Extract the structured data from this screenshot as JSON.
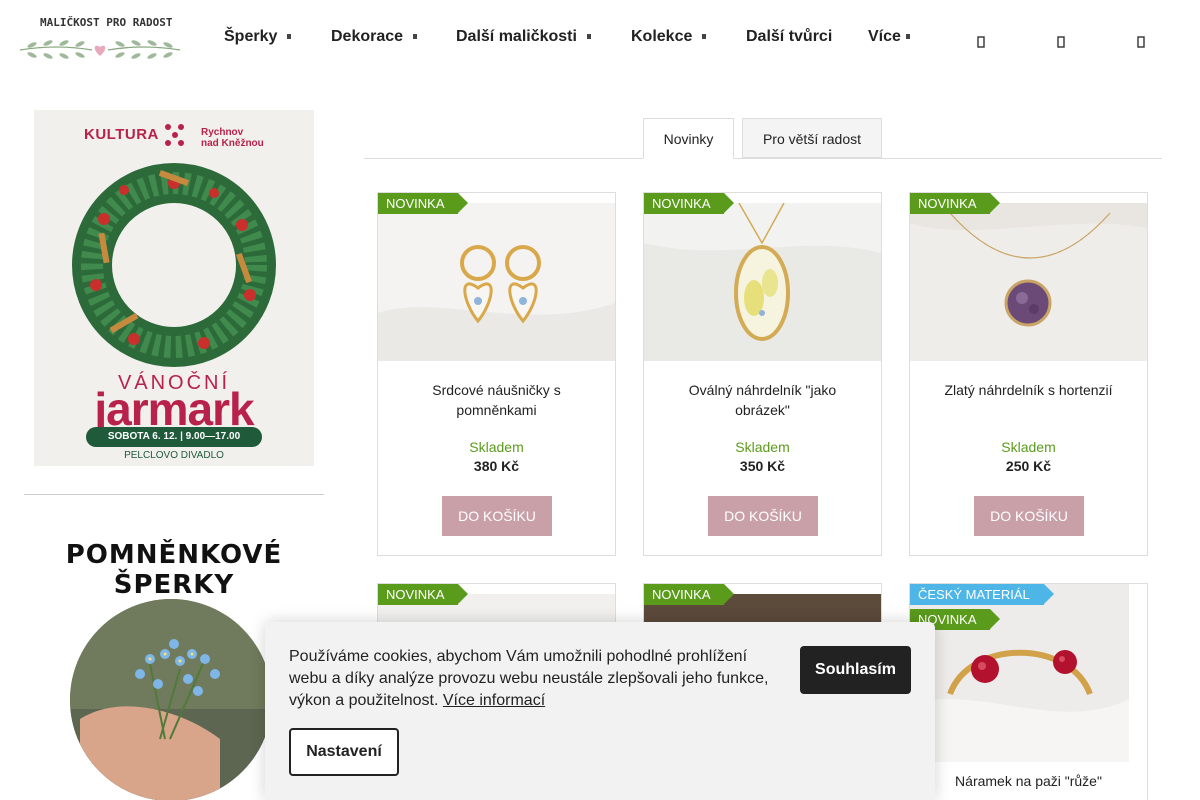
{
  "header": {
    "logo_text": "MALIČKOST PRO RADOST",
    "nav": [
      {
        "label": "Šperky",
        "has_dropdown": true
      },
      {
        "label": "Dekorace",
        "has_dropdown": true
      },
      {
        "label": "Další maličkosti",
        "has_dropdown": true
      },
      {
        "label": "Kolekce",
        "has_dropdown": true
      },
      {
        "label": "Další tvůrci",
        "has_dropdown": false
      },
      {
        "label": "Více",
        "has_dropdown": true
      }
    ],
    "icons": [
      "search-icon",
      "user-icon",
      "cart-icon"
    ]
  },
  "sidebar": {
    "banner": {
      "org": "KULTURA",
      "town_line1": "Rychnov",
      "town_line2": "nad Kněžnou",
      "event_line1": "VÁNOČNÍ",
      "event_line2": "jarmark",
      "date": "SOBOTA 6. 12. | 9.00—17.00",
      "venue": "PELCLOVO DIVADLO"
    },
    "heading": "POMNĚNKOVÉ ŠPERKY"
  },
  "tabs": [
    {
      "label": "Novinky",
      "active": true
    },
    {
      "label": "Pro větší radost",
      "active": false
    }
  ],
  "products": [
    {
      "flags": [
        "NOVINKA"
      ],
      "name": "Srdcové náušničky s pomněnkami",
      "stock": "Skladem",
      "price": "380 Kč",
      "button": "DO KOŠÍKU"
    },
    {
      "flags": [
        "NOVINKA"
      ],
      "name": "Oválný náhrdelník \"jako obrázek\"",
      "stock": "Skladem",
      "price": "350 Kč",
      "button": "DO KOŠÍKU"
    },
    {
      "flags": [
        "NOVINKA"
      ],
      "name": "Zlatý náhrdelník s hortenzií",
      "stock": "Skladem",
      "price": "250 Kč",
      "button": "DO KOŠÍKU"
    },
    {
      "flags": [
        "NOVINKA"
      ],
      "name": "",
      "stock": "",
      "price": "",
      "button": ""
    },
    {
      "flags": [
        "NOVINKA"
      ],
      "name": "",
      "stock": "",
      "price": "",
      "button": ""
    },
    {
      "flags": [
        "ČESKÝ MATERIÁL",
        "NOVINKA"
      ],
      "name": "Náramek na paži \"růže\"",
      "stock": "",
      "price": "",
      "button": ""
    }
  ],
  "cookie": {
    "text": "Používáme cookies, abychom Vám umožnili pohodlné prohlížení webu a díky analýze provozu webu neustále zlepšovali jeho funkce, výkon a použitelnost.",
    "more_link": "Více informací",
    "accept": "Souhlasím",
    "settings": "Nastavení"
  },
  "colors": {
    "accent_button": "#c9a0a8",
    "new_flag": "#5b9b1c",
    "material_flag": "#4eb6e6",
    "stock_text": "#5b9b1c",
    "banner_red": "#b8224a",
    "banner_green": "#1f5a3a"
  }
}
